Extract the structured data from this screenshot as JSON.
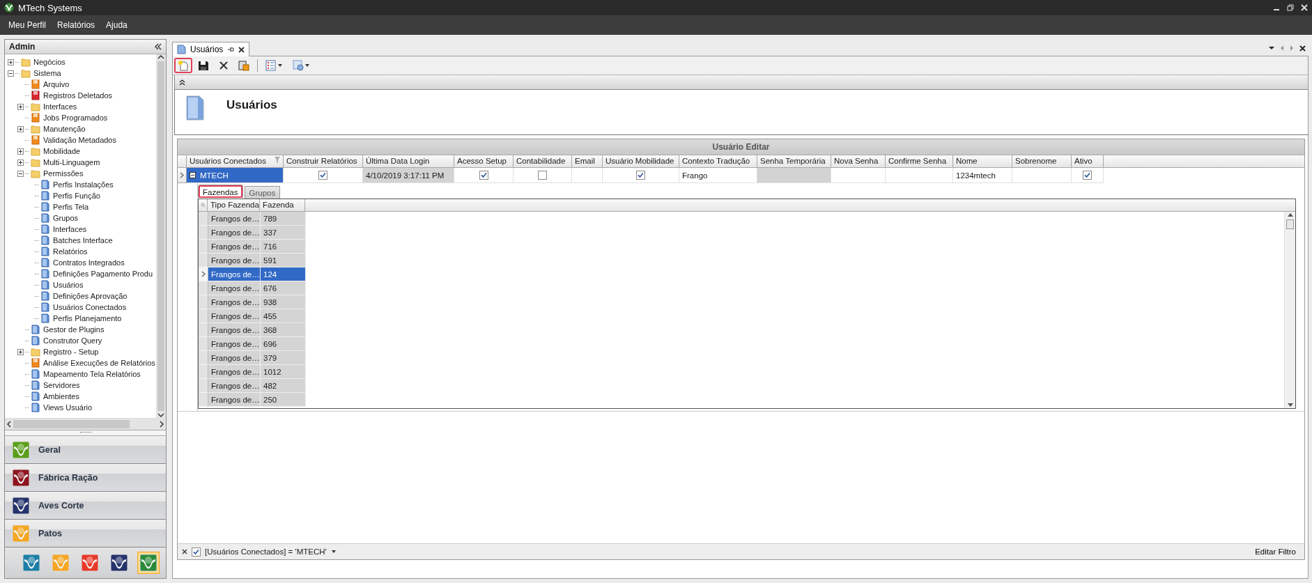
{
  "window": {
    "title": "MTech Systems"
  },
  "menu": [
    "Meu Perfil",
    "Relatórios",
    "Ajuda"
  ],
  "sidebar": {
    "title": "Admin",
    "tree": [
      {
        "label": "Negócios",
        "kind": "folder",
        "expanded": false
      },
      {
        "label": "Sistema",
        "kind": "folder",
        "expanded": true,
        "children": [
          {
            "label": "Arquivo",
            "kind": "orange"
          },
          {
            "label": "Registros Deletados",
            "kind": "red"
          },
          {
            "label": "Interfaces",
            "kind": "folder",
            "expanded": false
          },
          {
            "label": "Jobs Programados",
            "kind": "orange"
          },
          {
            "label": "Manutenção",
            "kind": "folder",
            "expanded": false
          },
          {
            "label": "Validação Metadados",
            "kind": "orange"
          },
          {
            "label": "Mobilidade",
            "kind": "folder",
            "expanded": false
          },
          {
            "label": "Multi-Linguagem",
            "kind": "folder",
            "expanded": false
          },
          {
            "label": "Permissões",
            "kind": "folder",
            "expanded": true,
            "children": [
              {
                "label": "Perfis Instalações",
                "kind": "blue"
              },
              {
                "label": "Perfis Função",
                "kind": "blue"
              },
              {
                "label": "Perfis Tela",
                "kind": "blue"
              },
              {
                "label": "Grupos",
                "kind": "blue"
              },
              {
                "label": "Interfaces",
                "kind": "blue"
              },
              {
                "label": "Batches Interface",
                "kind": "blue"
              },
              {
                "label": "Relatórios",
                "kind": "blue"
              },
              {
                "label": "Contratos Integrados",
                "kind": "blue"
              },
              {
                "label": "Definições Pagamento Produ",
                "kind": "blue"
              },
              {
                "label": "Usuários",
                "kind": "blue"
              },
              {
                "label": "Definições Aprovação",
                "kind": "blue"
              },
              {
                "label": "Usuários Conectados",
                "kind": "blue"
              },
              {
                "label": "Perfis Planejamento",
                "kind": "blue"
              }
            ]
          },
          {
            "label": "Gestor de Plugins",
            "kind": "blue"
          },
          {
            "label": "Construtor Query",
            "kind": "blue"
          },
          {
            "label": "Registro - Setup",
            "kind": "folder",
            "expanded": false
          },
          {
            "label": "Análise Execuções de Relatórios",
            "kind": "orange"
          },
          {
            "label": "Mapeamento Tela Relatórios",
            "kind": "blue"
          },
          {
            "label": "Servidores",
            "kind": "blue"
          },
          {
            "label": "Ambientes",
            "kind": "blue"
          },
          {
            "label": "Views Usuário",
            "kind": "blue"
          }
        ]
      }
    ],
    "groups": [
      {
        "label": "Geral",
        "color": "#5a9e1a"
      },
      {
        "label": "Fábrica Ração",
        "color": "#8e1520"
      },
      {
        "label": "Aves Corte",
        "color": "#25336b"
      },
      {
        "label": "Patos",
        "color": "#f5a623"
      }
    ],
    "shortcuts": [
      {
        "color": "#1b7fa6",
        "selected": false
      },
      {
        "color": "#f5a623",
        "selected": false
      },
      {
        "color": "#e83a2a",
        "selected": false
      },
      {
        "color": "#25336b",
        "selected": false
      },
      {
        "color": "#2a8a3a",
        "selected": true
      }
    ]
  },
  "document_tab": {
    "label": "Usuários"
  },
  "toolbar": [
    [
      {
        "kind": "new",
        "highlighted": true
      },
      {
        "kind": "save",
        "highlighted": false
      },
      {
        "kind": "delete",
        "highlighted": false
      },
      {
        "kind": "paste",
        "highlighted": false
      }
    ],
    [
      {
        "kind": "list",
        "highlighted": false
      },
      {
        "kind": "settings",
        "highlighted": false
      }
    ]
  ],
  "header": {
    "title": "Usuários"
  },
  "grid": {
    "title": "Usuário Editar",
    "columns": [
      "Usuários Conectados",
      "Construir Relatórios",
      "Última Data Login",
      "Acesso Setup",
      "Contabilidade",
      "Email",
      "Usuário Mobilidade",
      "Contexto Tradução",
      "Senha Temporária",
      "Nova Senha",
      "Confirme Senha",
      "Nome",
      "Sobrenome",
      "Ativo"
    ],
    "row": {
      "selected": true,
      "expanded": true,
      "cells": [
        {
          "kind": "text",
          "text": "MTECH"
        },
        {
          "kind": "check",
          "checked": true
        },
        {
          "kind": "shaded",
          "text": "4/10/2019 3:17:11 PM"
        },
        {
          "kind": "check",
          "checked": true
        },
        {
          "kind": "check",
          "checked": false
        },
        {
          "kind": "empty"
        },
        {
          "kind": "check",
          "checked": true
        },
        {
          "kind": "text",
          "text": "Frango"
        },
        {
          "kind": "shaded"
        },
        {
          "kind": "empty"
        },
        {
          "kind": "empty"
        },
        {
          "kind": "text",
          "text": "1234mtech"
        },
        {
          "kind": "empty"
        },
        {
          "kind": "check",
          "checked": true
        }
      ]
    }
  },
  "detail": {
    "tabs": [
      {
        "label": "Fazendas",
        "selected": true,
        "highlighted": true
      },
      {
        "label": "Grupos",
        "selected": false,
        "highlighted": false
      }
    ],
    "columns": [
      "Tipo Fazenda",
      "Fazenda"
    ],
    "rows": [
      {
        "tipo": "Frangos de…",
        "fazenda": "789",
        "selected": false
      },
      {
        "tipo": "Frangos de…",
        "fazenda": "337",
        "selected": false
      },
      {
        "tipo": "Frangos de…",
        "fazenda": "716",
        "selected": false
      },
      {
        "tipo": "Frangos de…",
        "fazenda": "591",
        "selected": false
      },
      {
        "tipo": "Frangos de…",
        "fazenda": "124",
        "selected": true
      },
      {
        "tipo": "Frangos de…",
        "fazenda": "676",
        "selected": false
      },
      {
        "tipo": "Frangos de…",
        "fazenda": "938",
        "selected": false
      },
      {
        "tipo": "Frangos de…",
        "fazenda": "455",
        "selected": false
      },
      {
        "tipo": "Frangos de…",
        "fazenda": "368",
        "selected": false
      },
      {
        "tipo": "Frangos de…",
        "fazenda": "696",
        "selected": false
      },
      {
        "tipo": "Frangos de…",
        "fazenda": "379",
        "selected": false
      },
      {
        "tipo": "Frangos de…",
        "fazenda": "1012",
        "selected": false
      },
      {
        "tipo": "Frangos de…",
        "fazenda": "482",
        "selected": false
      },
      {
        "tipo": "Frangos de…",
        "fazenda": "250",
        "selected": false
      }
    ]
  },
  "filter": {
    "enabled": true,
    "text": "[Usuários Conectados] = 'MTECH'",
    "edit_label": "Editar Filtro"
  }
}
